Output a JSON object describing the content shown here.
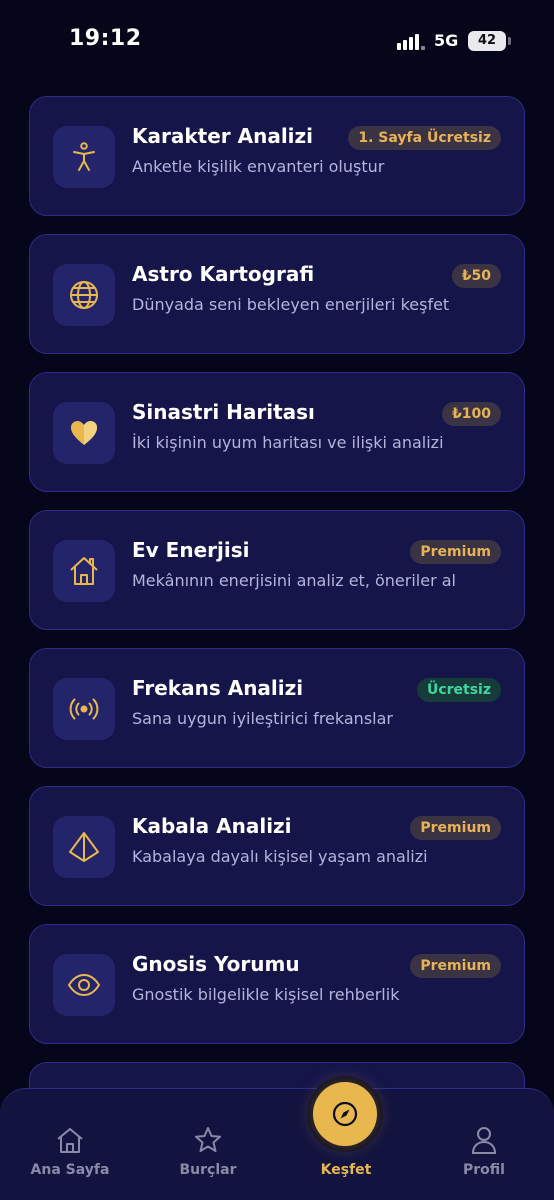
{
  "status_bar": {
    "time": "19:12",
    "network": "5G",
    "battery": "42"
  },
  "colors": {
    "background": "#06061a",
    "card": "#15154a",
    "accent_gold": "#e8b84e",
    "free_green": "#3ed6a0"
  },
  "cards": [
    {
      "title": "Karakter Analizi",
      "description": "Anketle kişilik envanteri oluştur",
      "badge": "1. Sayfa Ücretsiz",
      "icon": "person-icon"
    },
    {
      "title": "Astro Kartografi",
      "description": "Dünyada seni bekleyen enerjileri keşfet",
      "badge": "₺50",
      "icon": "globe-icon"
    },
    {
      "title": "Sinastri Haritası",
      "description": "İki kişinin uyum haritası ve ilişki analizi",
      "badge": "₺100",
      "icon": "heart-icon"
    },
    {
      "title": "Ev Enerjisi",
      "description": "Mekânının enerjisini analiz et, öneriler al",
      "badge": "Premium",
      "icon": "house-icon"
    },
    {
      "title": "Frekans Analizi",
      "description": "Sana uygun iyileştirici frekanslar",
      "badge": "Ücretsiz",
      "icon": "broadcast-icon"
    },
    {
      "title": "Kabala Analizi",
      "description": "Kabalaya dayalı kişisel yaşam analizi",
      "badge": "Premium",
      "icon": "pyramid-icon"
    },
    {
      "title": "Gnosis Yorumu",
      "description": "Gnostik bilgelikle kişisel rehberlik",
      "badge": "Premium",
      "icon": "eye-icon"
    }
  ],
  "nav": {
    "home": "Ana Sayfa",
    "signs": "Burçlar",
    "explore": "Keşfet",
    "profile": "Profil"
  }
}
